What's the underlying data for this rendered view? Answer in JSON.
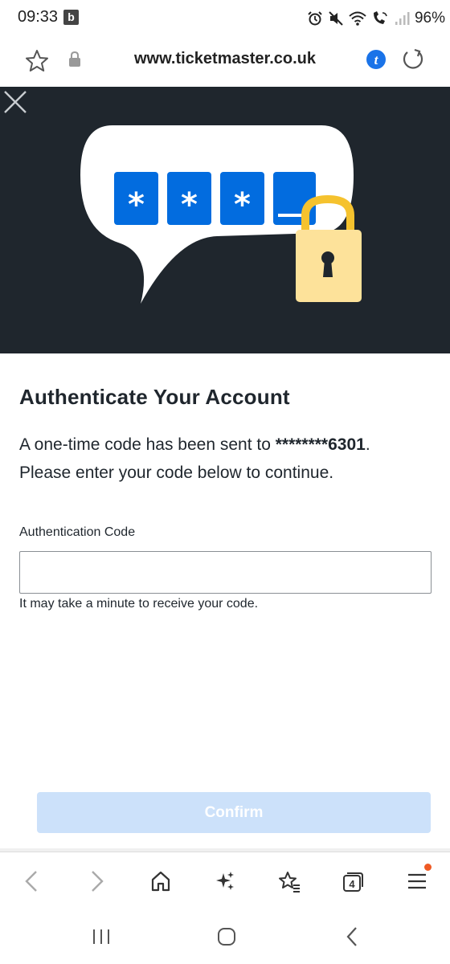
{
  "status_bar": {
    "time": "09:33",
    "notification_badge": "b",
    "battery": "96%"
  },
  "browser": {
    "url": "www.ticketmaster.co.uk",
    "extension_badge": "t"
  },
  "modal": {
    "title": "Authenticate Your Account",
    "description_prefix": "A one-time code has been sent to ",
    "masked_phone": "********6301",
    "description_suffix": ".",
    "description_line2": "Please enter your code below to continue.",
    "field_label": "Authentication Code",
    "field_value": "",
    "field_placeholder": "",
    "helper_text": "It may take a minute to receive your code.",
    "confirm_label": "Confirm",
    "confirm_enabled": false,
    "hero_code_chars": [
      "*",
      "*",
      "*"
    ]
  },
  "toolbar": {
    "tabs_count": "4",
    "menu_has_notification": true
  },
  "colors": {
    "hero_bg": "#1f262d",
    "accent_blue": "#026cdf",
    "confirm_disabled": "#cce1fa",
    "lock_body": "#fde29a",
    "lock_shackle": "#f5c22e",
    "notification_dot": "#ef5a24"
  },
  "icons": {
    "status": [
      "alarm-icon",
      "mute-icon",
      "wifi-icon",
      "wifi-call-icon",
      "signal-icon"
    ],
    "url_bar": [
      "star-icon",
      "lock-icon",
      "extension-icon",
      "reload-icon"
    ],
    "toolbar": [
      "back-icon",
      "forward-icon",
      "home-icon",
      "sparkle-icon",
      "bookmarks-icon",
      "tabs-icon",
      "menu-icon"
    ],
    "nav": [
      "recents-icon",
      "home-button-icon",
      "nav-back-icon"
    ]
  }
}
